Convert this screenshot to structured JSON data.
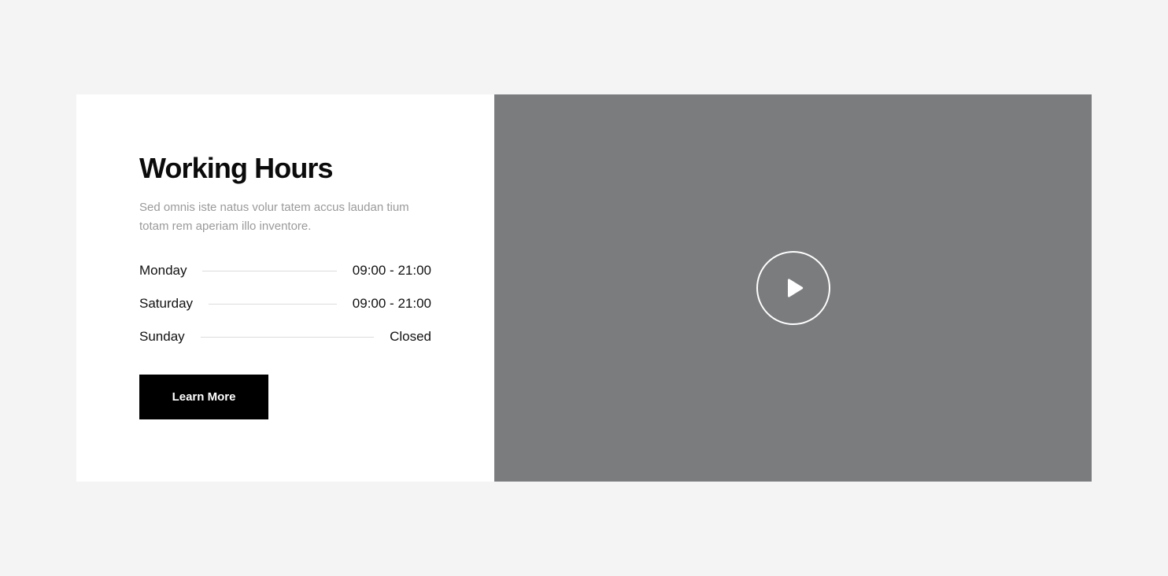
{
  "working_hours": {
    "title": "Working Hours",
    "description": "Sed omnis iste natus volur tatem accus laudan tium totam rem aperiam illo inventore.",
    "rows": [
      {
        "day": "Monday",
        "time": "09:00 - 21:00"
      },
      {
        "day": "Saturday",
        "time": "09:00 - 21:00"
      },
      {
        "day": "Sunday",
        "time": "Closed"
      }
    ],
    "button_label": "Learn More"
  },
  "video": {
    "play_icon": "play-icon",
    "background_color": "#7b7c7e"
  },
  "colors": {
    "page_background": "#f4f4f4",
    "card_background": "#ffffff",
    "button_background": "#000000",
    "text_primary": "#111111",
    "text_muted": "#9a9a9a"
  }
}
